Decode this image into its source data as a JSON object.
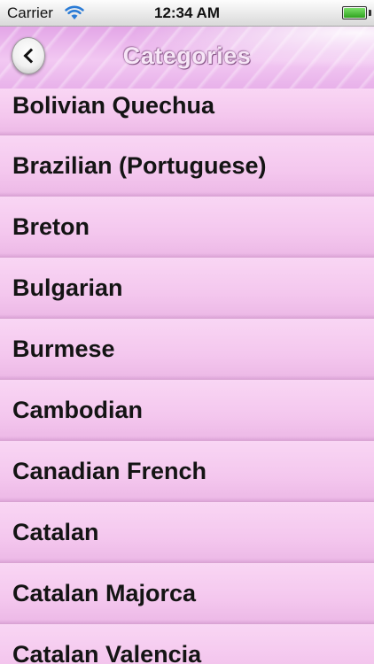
{
  "status_bar": {
    "carrier": "Carrier",
    "time": "12:34 AM"
  },
  "nav_bar": {
    "title": "Categories",
    "back_icon": "chevron-left-icon"
  },
  "categories": [
    "Bolivian Quechua",
    "Brazilian (Portuguese)",
    "Breton",
    "Bulgarian",
    "Burmese",
    "Cambodian",
    "Canadian French",
    "Catalan",
    "Catalan Majorca",
    "Catalan Valencia"
  ]
}
